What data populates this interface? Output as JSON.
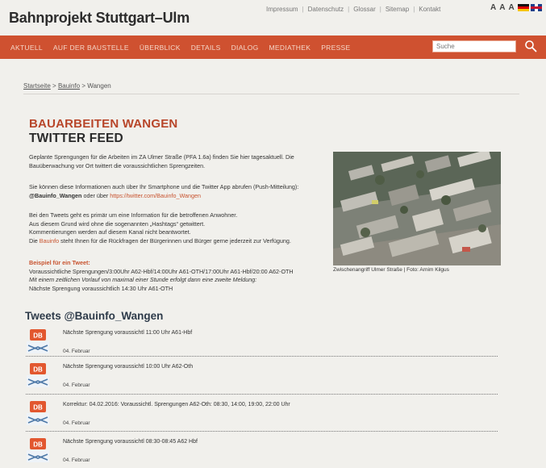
{
  "site": {
    "logo": "Bahnprojekt Stuttgart–Ulm",
    "meta_links": [
      "Impressum",
      "Datenschutz",
      "Glossar",
      "Sitemap",
      "Kontakt"
    ],
    "font_size_label": "A A A",
    "colors": {
      "brand_orange": "#cf5130",
      "title_orange": "#b8462a",
      "background": "#f1f0ec"
    }
  },
  "nav": {
    "items": [
      "Aktuell",
      "Auf der Baustelle",
      "Überblick",
      "Details",
      "Dialog",
      "Mediathek",
      "Presse"
    ],
    "search_placeholder": "Suche",
    "search_icon": "search-icon"
  },
  "breadcrumb": [
    "Startseite",
    "Bauinfo",
    "Wangen"
  ],
  "article": {
    "title_line1": "BAUARBEITEN WANGEN",
    "title_line2": "TWITTER FEED",
    "p1": "Geplante Sprengungen für die Arbeiten im ZA Ulmer Straße (PFA 1.6a) finden Sie hier tagesaktuell. Die Bauüberwachung vor Ort twittert die voraussichtlichen Sprengzeiten.",
    "p2_a": "Sie können diese Informationen auch über Ihr Smartphone und die Twitter App abrufen (Push-Mitteilung): ",
    "p2_handle": "@Bauinfo_Wangen",
    "p2_b": " oder über ",
    "p2_link": "https://twitter.com/Bauinfo_Wangen",
    "p3_line1": "Bei den Tweets geht es primär um eine Information für die betroffenen Anwohner.",
    "p3_line2": "Aus diesem Grund wird ohne die sogenannten „Hashtags“ getwittert.",
    "p3_line3": "Kommentierungen werden auf diesem Kanal nicht beantwortet.",
    "p3_line4_a": "Die ",
    "p3_line4_link": "Bauinfo",
    "p3_line4_b": " steht Ihnen für die Rückfragen der Bürgerinnen und Bürger gerne jederzeit zur Verfügung.",
    "example_title": "Beispiel für ein Tweet:",
    "example_line1": "Voraussichtliche Sprengungen/3:00Uhr A62-Hbf/14:00Uhr A61-OTH/17:00Uhr A61-Hbf/20:00 A62-OTH",
    "example_line2": "Mit einem zeitlichen Vorlauf von maximal einer Stunde erfolgt dann eine zweite Meldung:",
    "example_line3": "Nächste Sprengung voraussichtlich 14:30 Uhr A61-OTH",
    "photo_caption": "Zwischenangriff Ulmer Straße | Foto: Arnim Kilgus"
  },
  "tweets_heading": "Tweets @Bauinfo_Wangen",
  "tweets": [
    {
      "text": "Nächste Sprengung voraussichtl 11:00 Uhr A61-Hbf",
      "date": "04. Februar"
    },
    {
      "text": "Nächste Sprengung voraussichtl 10:00 Uhr A62-Oth",
      "date": "04. Februar"
    },
    {
      "text": "Korrektur: 04.02.2016: Voraussichtl. Sprengungen A62-Oth: 08:30, 14:00, 19:00, 22:00 Uhr",
      "date": "04. Februar"
    },
    {
      "text": "Nächste Sprengung voraussichtl 08:30-08:45 A62 Hbf",
      "date": "04. Februar"
    }
  ]
}
